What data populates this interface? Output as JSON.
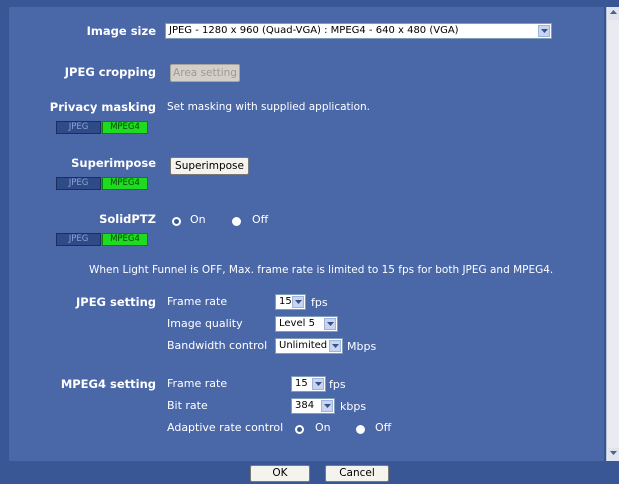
{
  "image_size": {
    "label": "Image size",
    "value": "JPEG - 1280 x 960 (Quad-VGA) : MPEG4 - 640 x 480 (VGA)"
  },
  "jpeg_cropping": {
    "label": "JPEG cropping",
    "button": "Area setting"
  },
  "privacy_masking": {
    "label": "Privacy masking",
    "text": "Set masking with supplied application."
  },
  "superimpose": {
    "label": "Superimpose",
    "button": "Superimpose"
  },
  "solidptz": {
    "label": "SolidPTZ",
    "on": "On",
    "off": "Off",
    "selected": "On"
  },
  "tags": {
    "jpeg": "JPEG",
    "mpeg4": "MPEG4"
  },
  "note": "When Light Funnel is OFF, Max. frame rate is limited to 15 fps for both JPEG and MPEG4.",
  "jpeg_setting": {
    "label": "JPEG setting",
    "frame_rate_label": "Frame rate",
    "frame_rate": "15",
    "fps": "fps",
    "quality_label": "Image quality",
    "quality": "Level 5",
    "bandwidth_label": "Bandwidth control",
    "bandwidth": "Unlimited",
    "mbps": "Mbps"
  },
  "mpeg4_setting": {
    "label": "MPEG4 setting",
    "frame_rate_label": "Frame rate",
    "frame_rate": "15",
    "fps": "fps",
    "bit_rate_label": "Bit rate",
    "bit_rate": "384",
    "kbps": "kbps",
    "adaptive_label": "Adaptive rate control",
    "on": "On",
    "off": "Off",
    "selected": "On"
  },
  "footer": {
    "ok": "OK",
    "cancel": "Cancel"
  },
  "colors": {
    "background": "#3a5795",
    "panel": "#4a67a8",
    "mpeg4_tag": "#1fdb1f"
  }
}
